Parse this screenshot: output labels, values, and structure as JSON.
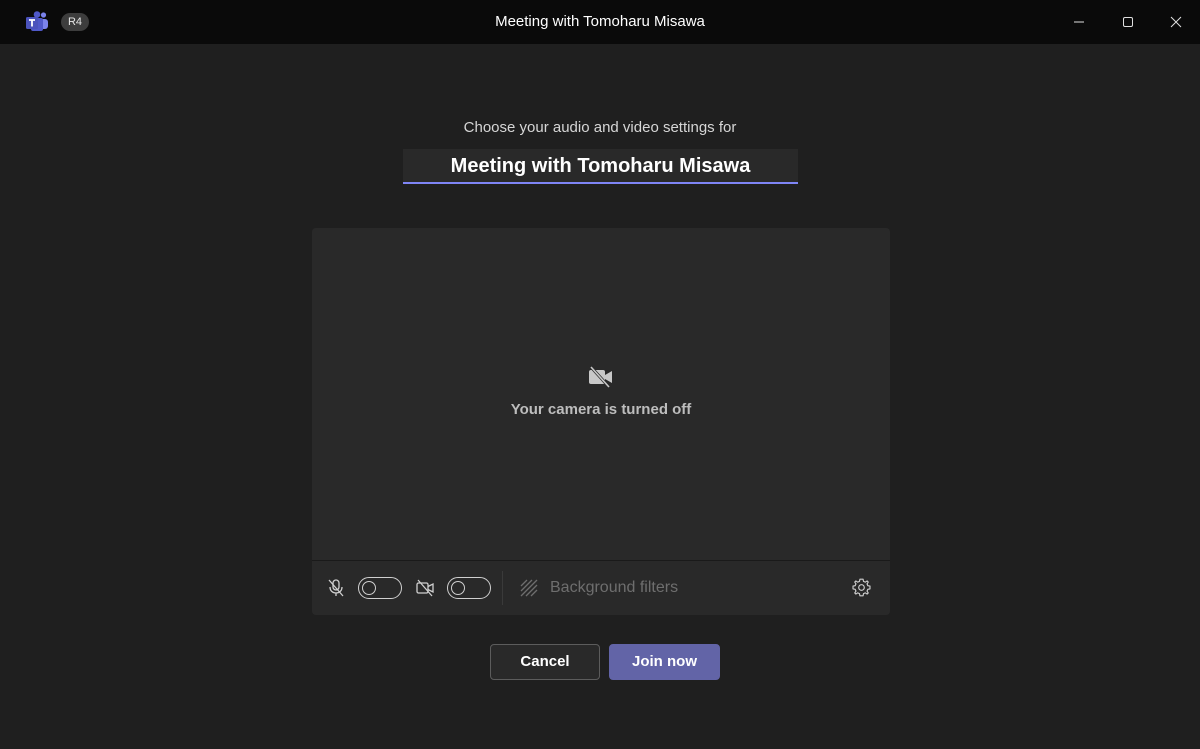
{
  "titlebar": {
    "app_icon": "teams-logo-icon",
    "ring_badge": "R4",
    "title": "Meeting with Tomoharu Misawa",
    "minimize_icon": "minimize-icon",
    "maximize_icon": "maximize-icon",
    "close_icon": "close-icon"
  },
  "prejoin": {
    "subtitle": "Choose your audio and video settings for",
    "meeting_name": "Meeting with Tomoharu Misawa"
  },
  "preview": {
    "camera_off_icon": "video-off-icon",
    "camera_off_text": "Your camera is turned off"
  },
  "controls": {
    "mic_icon": "mic-off-icon",
    "mic_toggle_on": false,
    "video_icon": "video-off-icon",
    "video_toggle_on": false,
    "background_filters_icon": "background-filters-icon",
    "background_filters_label": "Background filters",
    "settings_icon": "gear-icon"
  },
  "actions": {
    "cancel_label": "Cancel",
    "join_label": "Join now"
  },
  "colors": {
    "accent": "#6264a7",
    "underline": "#7f85f5",
    "background": "#1f1f1f",
    "panel": "#292929"
  }
}
